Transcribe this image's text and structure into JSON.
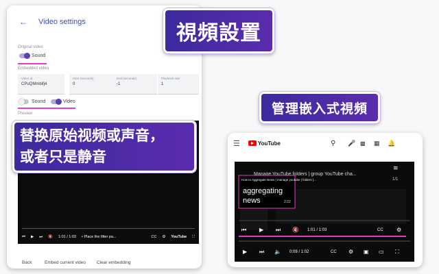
{
  "settings": {
    "title": "Video settings",
    "original_video_label": "Original video",
    "sound_label": "Sound",
    "embedded_video_label": "Embedded video",
    "fields": [
      {
        "label": "Video id",
        "value": "CPuQMmbifj4"
      },
      {
        "label": "Start (seconds)",
        "value": "0"
      },
      {
        "label": "End (seconds)",
        "value": "-1"
      },
      {
        "label": "Playback rate",
        "value": "1"
      }
    ],
    "embed_sound_label": "Sound",
    "embed_video_label": "Video",
    "preview_label": "Preview",
    "player_time": "1:01 / 1:03",
    "player_chapter": "• Place the filter pa...",
    "footer": {
      "back": "Back",
      "embed": "Embed current video",
      "clear": "Clear embedding"
    }
  },
  "callouts": {
    "video_settings": "視頻設置",
    "manage_embedded": "管理嵌入式視頻",
    "replace_line1": "替换原始视频或声音，",
    "replace_line2": "或者只是静音"
  },
  "youtube": {
    "logo_text": "YouTube",
    "video_title": "Manage YouTube folders | group YouTube cha...",
    "playlist_count": "1/1",
    "inner_title": "How to Aggregate News | manage youtube | folders |...",
    "inner_big_text": "aggregating news",
    "inner_duration": "2:22",
    "embed_time": "1:01 / 1:03",
    "outer_time": "0:09 / 1:02"
  },
  "colors": {
    "accent": "#3f51b5",
    "callout": "#4a2ba7",
    "highlight": "#e63bc4",
    "youtube_red": "#ff0000"
  }
}
